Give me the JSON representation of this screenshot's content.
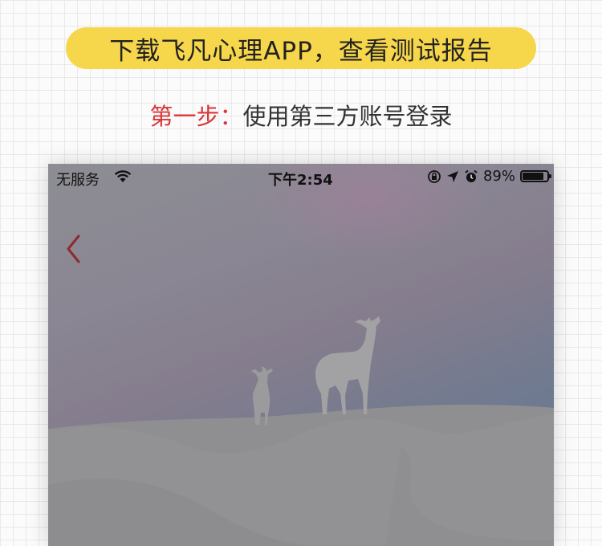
{
  "banner": {
    "text": "下载飞凡心理APP，查看测试报告"
  },
  "step": {
    "label": "第一步：",
    "text": "使用第三方账号登录"
  },
  "phone": {
    "status_bar": {
      "carrier": "无服务",
      "time": "下午2:54",
      "battery_percent": "89%",
      "battery_level": 0.89
    },
    "icons": [
      "wifi-icon",
      "orientation-lock-icon",
      "location-arrow-icon",
      "alarm-icon",
      "battery-icon",
      "back-chevron-icon"
    ],
    "colors": {
      "back_chevron": "#8e2a30",
      "banner": "#f6d64a",
      "step_label": "#d9363a"
    }
  }
}
